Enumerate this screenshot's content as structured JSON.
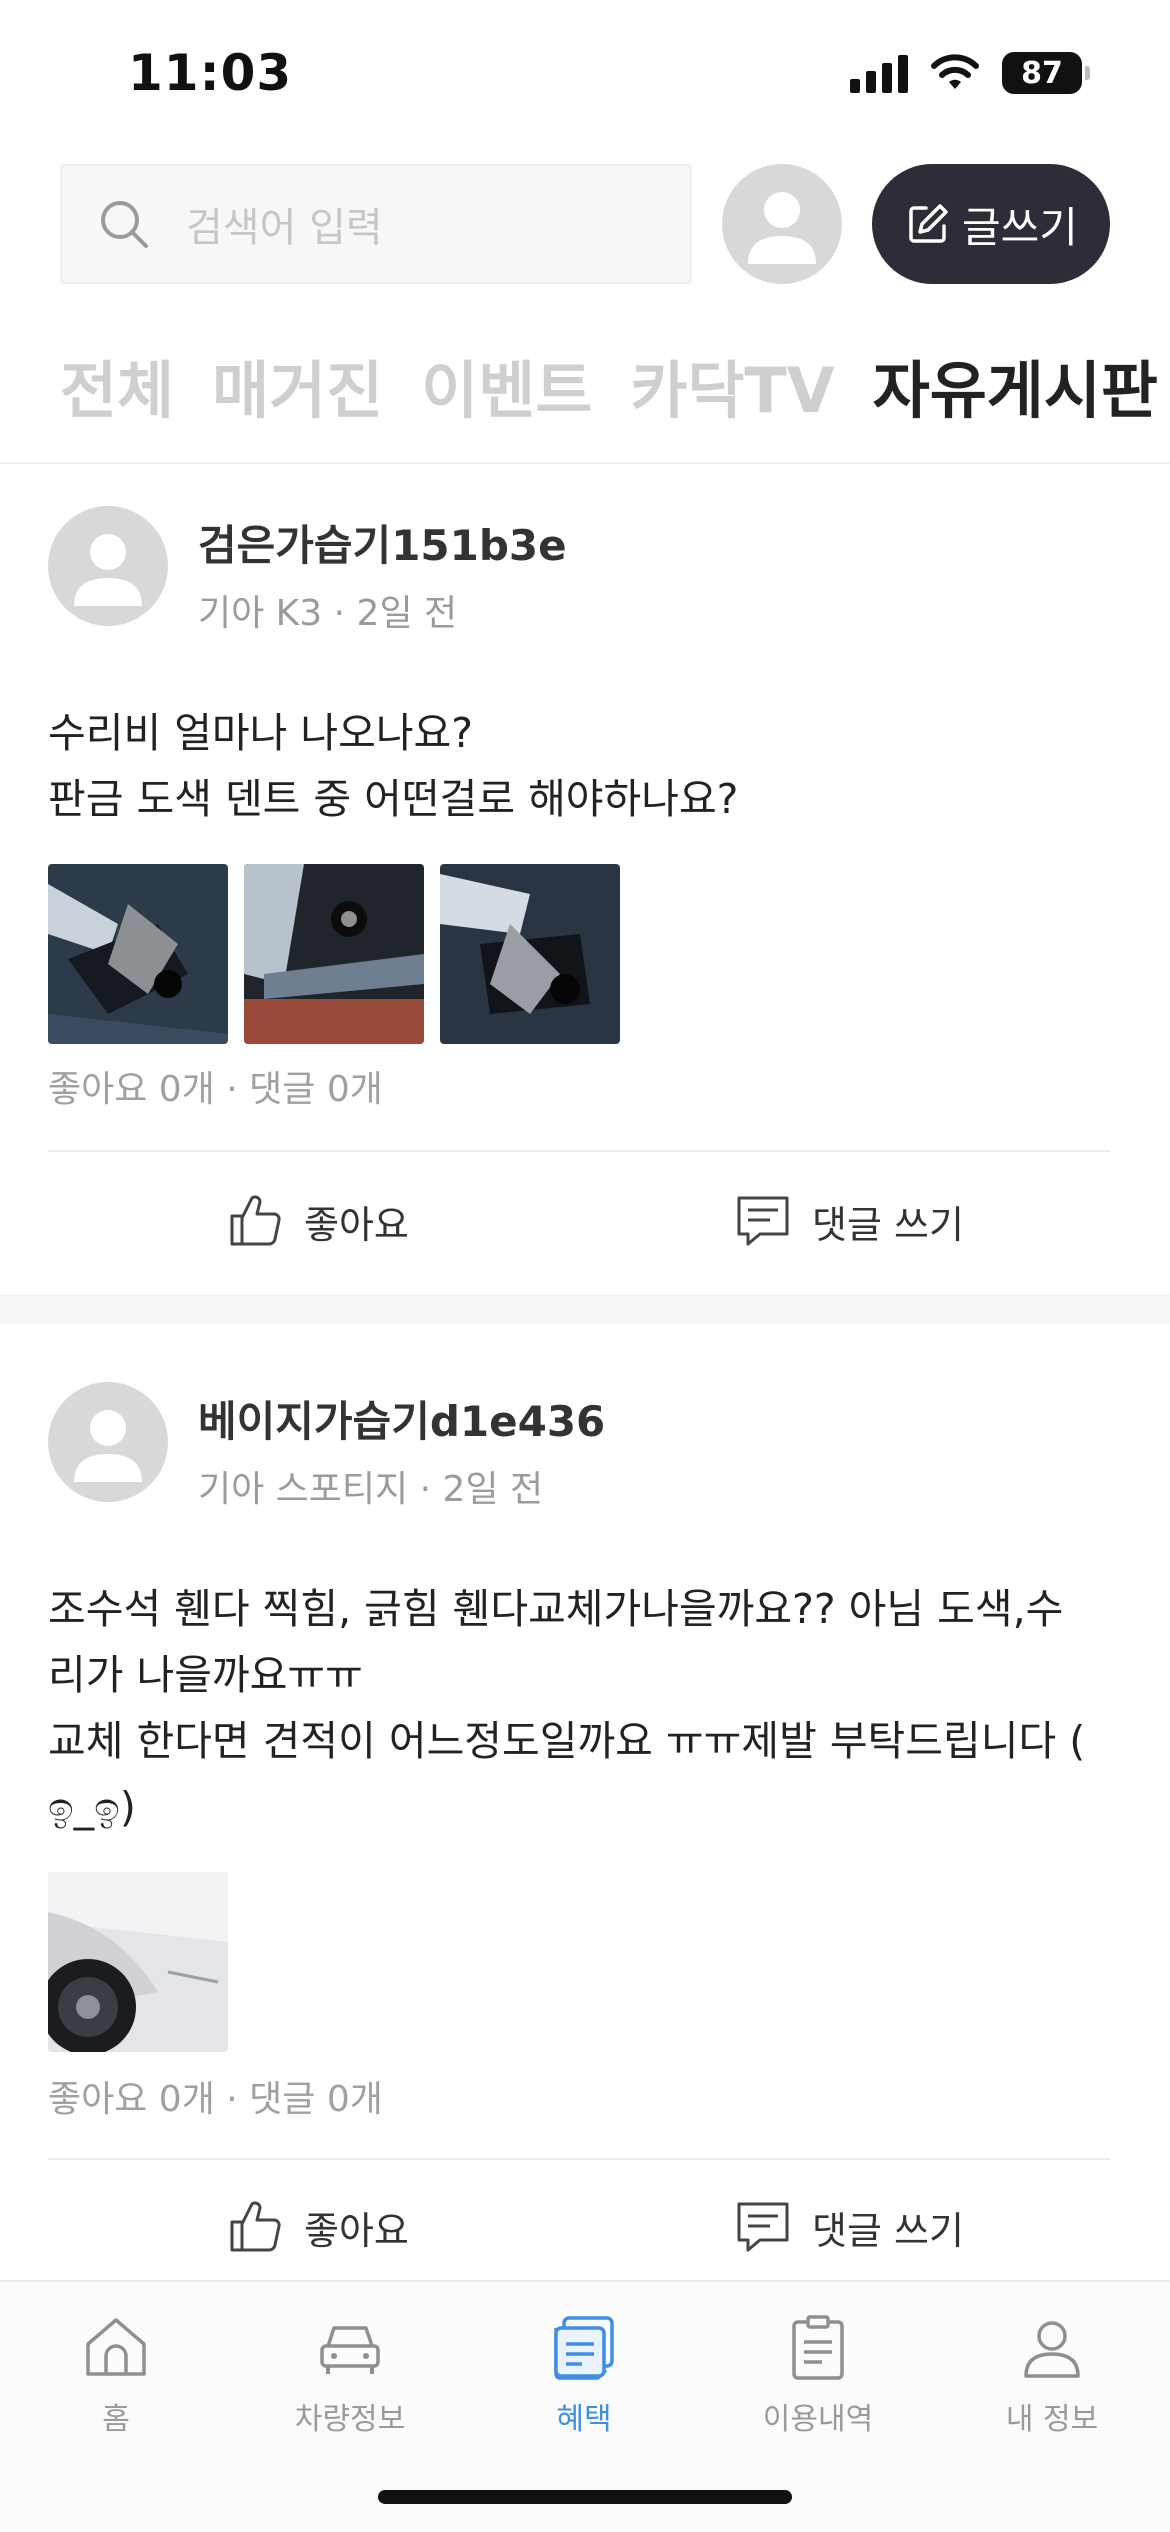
{
  "status": {
    "time": "11:03",
    "battery": "87"
  },
  "search": {
    "placeholder": "검색어 입력"
  },
  "header": {
    "write_label": "글쓰기"
  },
  "tabs": [
    {
      "label": "전체",
      "active": false
    },
    {
      "label": "매거진",
      "active": false
    },
    {
      "label": "이벤트",
      "active": false
    },
    {
      "label": "카닥TV",
      "active": false
    },
    {
      "label": "자유게시판",
      "active": true
    }
  ],
  "posts": [
    {
      "author": "검은가습기151b3e",
      "car": "기아 K3",
      "time": "2일 전",
      "lines": [
        "수리비 얼마나 나오나요?",
        "판금 도색 덴트 중 어떤걸로 해야하나요?"
      ],
      "likes_text": "좋아요 0개",
      "comments_text": "댓글 0개",
      "like_label": "좋아요",
      "comment_label": "댓글 쓰기"
    },
    {
      "author": "베이지가습기d1e436",
      "car": "기아 스포티지",
      "time": "2일 전",
      "lines": [
        "조수석 휀다 찍힘, 긁힘 휀다교체가나을까요?? 아님 도색,수",
        "리가 나을까요ㅠㅠ",
        "교체 한다면 견적이 어느정도일까요 ㅠㅠ제발 부탁드립니다 (",
        "ඉ_ඉ)"
      ],
      "likes_text": "좋아요 0개",
      "comments_text": "댓글 0개",
      "like_label": "좋아요",
      "comment_label": "댓글 쓰기"
    }
  ],
  "nav": [
    {
      "label": "홈",
      "icon": "home-icon",
      "active": false
    },
    {
      "label": "차량정보",
      "icon": "car-icon",
      "active": false
    },
    {
      "label": "혜택",
      "icon": "benefit-icon",
      "active": true
    },
    {
      "label": "이용내역",
      "icon": "clipboard-icon",
      "active": false
    },
    {
      "label": "내 정보",
      "icon": "person-icon",
      "active": false
    }
  ],
  "colors": {
    "accent": "#3f8ee6",
    "write_button": "#2c2d36",
    "muted": "#cfcfd2"
  }
}
